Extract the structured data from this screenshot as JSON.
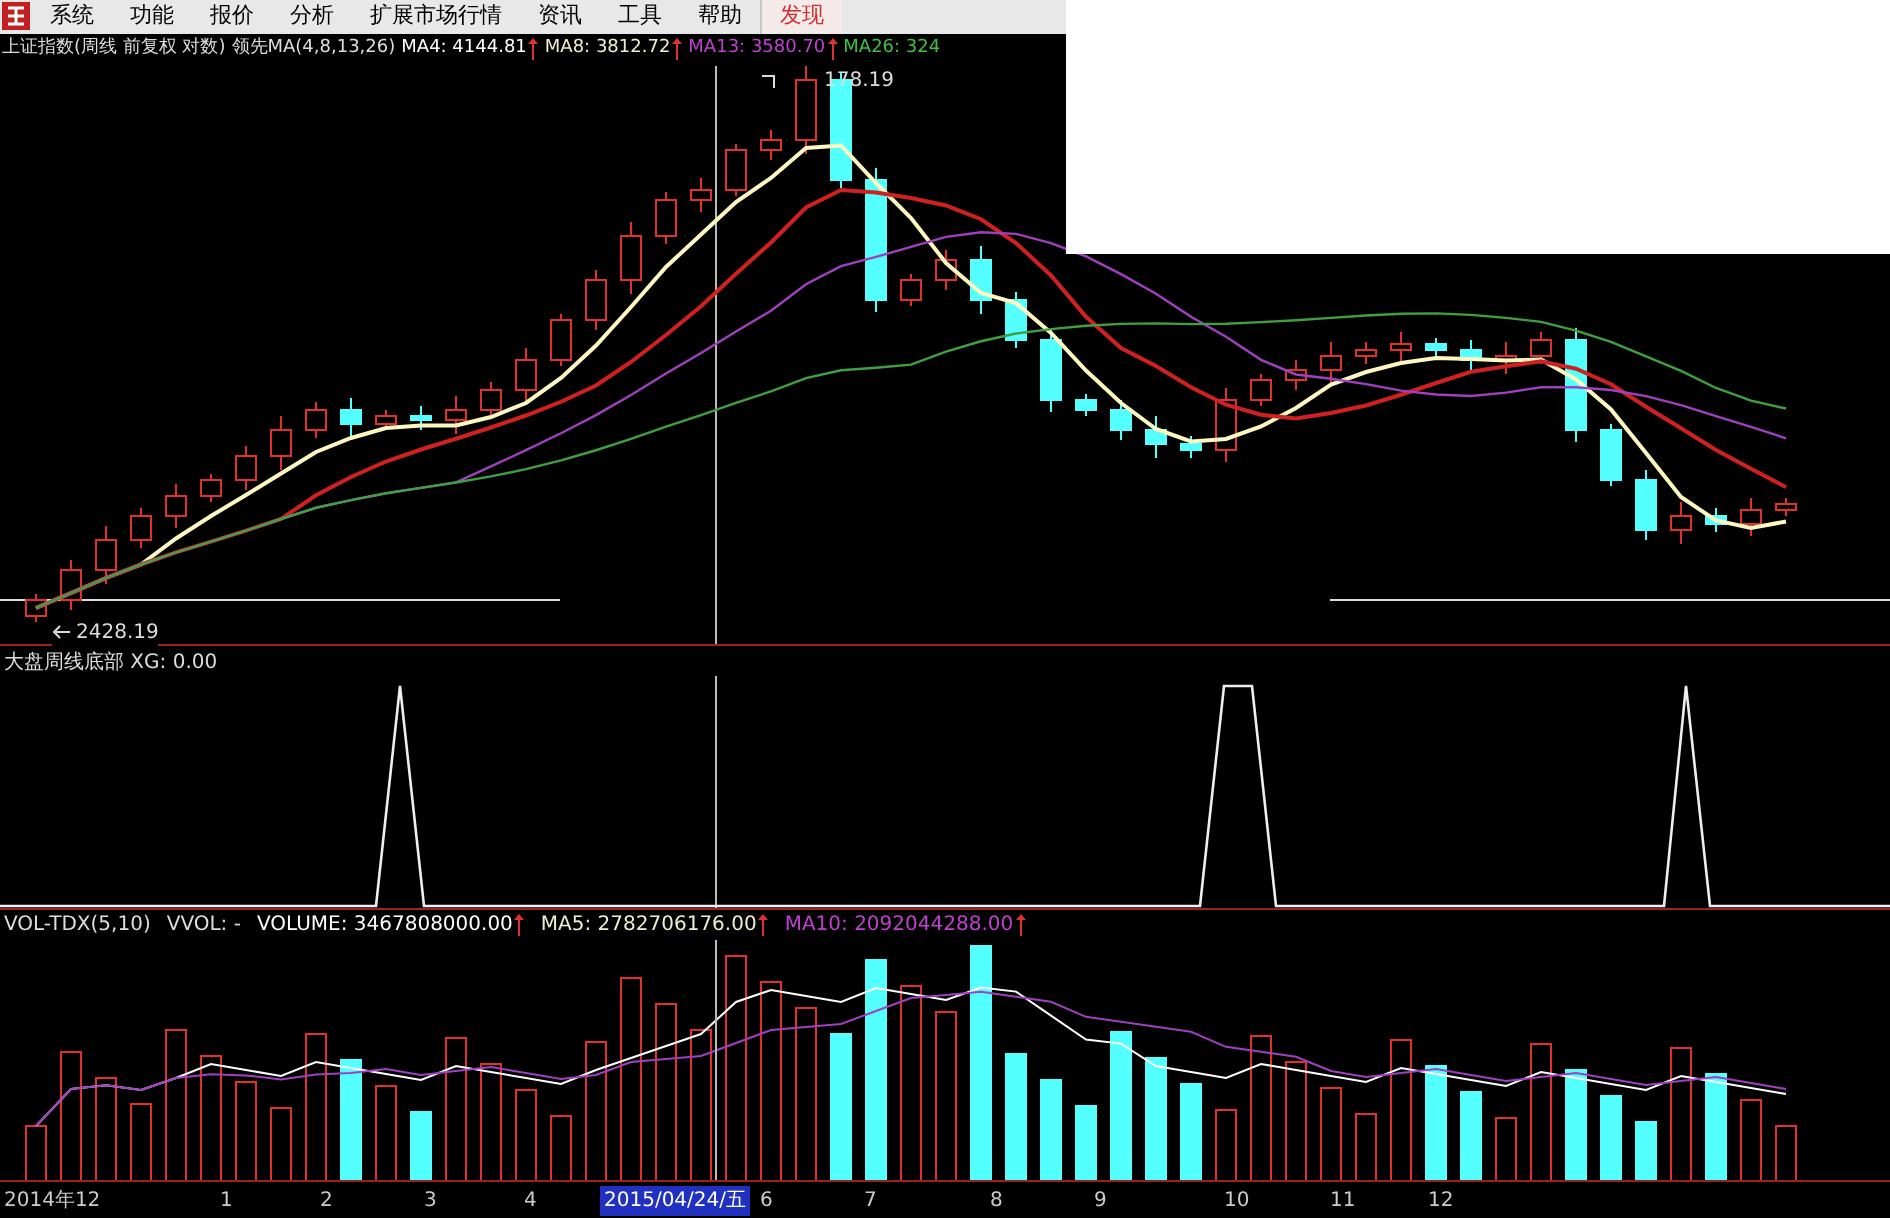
{
  "menu": [
    {
      "label": "系统",
      "selected": false
    },
    {
      "label": "功能",
      "selected": false
    },
    {
      "label": "报价",
      "selected": false
    },
    {
      "label": "分析",
      "selected": false
    },
    {
      "label": "扩展市场行情",
      "selected": false
    },
    {
      "label": "资讯",
      "selected": false
    },
    {
      "label": "工具",
      "selected": false
    },
    {
      "label": "帮助",
      "selected": false
    },
    {
      "label": "发现",
      "selected": true
    }
  ],
  "price_header": {
    "title": "上证指数(周线 前复权 对数)",
    "indicator": "领先MA(4,8,13,26)",
    "averages": [
      {
        "label": "MA4: 4144.81",
        "color": "#ffffff",
        "trend_up": true
      },
      {
        "label": "MA8: 3812.72",
        "color": "#f0ecd0",
        "trend_up": true
      },
      {
        "label": "MA13: 3580.70",
        "color": "#c040d0",
        "trend_up": true
      },
      {
        "label": "MA26: 324",
        "color": "#40c040",
        "trend_up": false
      }
    ]
  },
  "price_marks": {
    "high_label": "178.19",
    "low_label": "2428.19"
  },
  "signal_header": "大盘周线底部 XG: 0.00",
  "volume_header": {
    "indicator": "VOL-TDX(5,10)",
    "vvol": "VVOL: -",
    "readings": [
      {
        "label": "VOLUME: 3467808000.00",
        "color": "#ffffff",
        "trend_up": true
      },
      {
        "label": "MA5: 2782706176.00",
        "color": "#f0ecd0",
        "trend_up": true
      },
      {
        "label": "MA10: 2092044288.00",
        "color": "#c040d0",
        "trend_up": true
      }
    ]
  },
  "x_axis": [
    {
      "label": "2014年12",
      "selected": false
    },
    {
      "label": "1",
      "selected": false
    },
    {
      "label": "2",
      "selected": false
    },
    {
      "label": "3",
      "selected": false
    },
    {
      "label": "4",
      "selected": false
    },
    {
      "label": "2015/04/24/五",
      "selected": true
    },
    {
      "label": "6",
      "selected": false
    },
    {
      "label": "7",
      "selected": false
    },
    {
      "label": "8",
      "selected": false
    },
    {
      "label": "9",
      "selected": false
    },
    {
      "label": "10",
      "selected": false
    },
    {
      "label": "11",
      "selected": false
    },
    {
      "label": "12",
      "selected": false
    }
  ]
}
